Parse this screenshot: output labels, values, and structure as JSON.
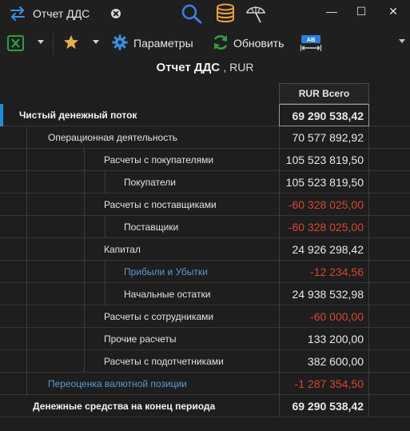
{
  "window": {
    "tab_title": "Отчет ДДС",
    "icons": [
      "swap-arrows-icon",
      "close-tab-icon",
      "search-icon",
      "database-icon",
      "beach-umbrella-icon"
    ],
    "controls": {
      "minimize": "—",
      "maximize": "☐",
      "close": "✕"
    }
  },
  "toolbar": {
    "excel_icon": "excel-icon",
    "favorites_icon": "star-icon",
    "params_label": "Параметры",
    "refresh_label": "Обновить",
    "ab_icon_text": "AB"
  },
  "report": {
    "title": "Отчет ДДС",
    "currency": ", RUR",
    "column_header": "RUR Всего",
    "accent_color": "#1e8fd6",
    "negative_color": "#d9452e",
    "link_color": "#5b9bd5",
    "rows": [
      {
        "label": "Чистый денежный поток",
        "value": "69 290 538,42",
        "level": 0,
        "bold": true,
        "accent": true,
        "selected": true
      },
      {
        "label": "Операционная деятельность",
        "value": "70 577 892,92",
        "level": 1
      },
      {
        "label": "Расчеты с покупателями",
        "value": "105 523 819,50",
        "level": 2
      },
      {
        "label": "Покупатели",
        "value": "105 523 819,50",
        "level": 3
      },
      {
        "label": "Расчеты с поставщиками",
        "value": "-60 328 025,00",
        "level": 2,
        "negative": true
      },
      {
        "label": "Поставщики",
        "value": "-60 328 025,00",
        "level": 3,
        "negative": true
      },
      {
        "label": "Капитал",
        "value": "24 926 298,42",
        "level": 2
      },
      {
        "label": "Прибыли и Убытки",
        "value": "-12 234,56",
        "level": 3,
        "negative": true,
        "link": true
      },
      {
        "label": "Начальные остатки",
        "value": "24 938 532,98",
        "level": 3
      },
      {
        "label": "Расчеты с сотрудниками",
        "value": "-60 000,00",
        "level": 2,
        "negative": true
      },
      {
        "label": "Прочие расчеты",
        "value": "133 200,00",
        "level": 2
      },
      {
        "label": "Расчеты с подотчетниками",
        "value": "382 600,00",
        "level": 2
      },
      {
        "label": "Переоценка валютной позиции",
        "value": "-1 287 354,50",
        "level": 1,
        "negative": true,
        "link": true
      },
      {
        "label": "Денежные средства на конец периода",
        "value": "69 290 538,42",
        "level": 0,
        "bold": true
      }
    ]
  }
}
